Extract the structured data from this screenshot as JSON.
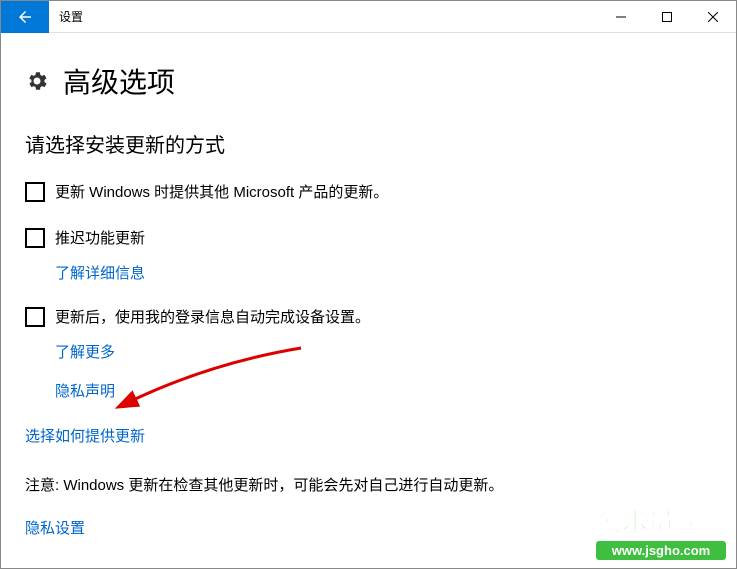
{
  "titlebar": {
    "title": "设置"
  },
  "heading": "高级选项",
  "subheading": "请选择安装更新的方式",
  "options": {
    "opt1": {
      "label": "更新 Windows 时提供其他 Microsoft 产品的更新。"
    },
    "opt2": {
      "label": "推迟功能更新",
      "link": "了解详细信息"
    },
    "opt3": {
      "label": "更新后，使用我的登录信息自动完成设备设置。",
      "link": "了解更多"
    }
  },
  "privacy_notice": "隐私声明",
  "delivery_link": "选择如何提供更新",
  "note": "注意: Windows 更新在检查其他更新时，可能会先对自己进行自动更新。",
  "privacy_settings": "隐私设置",
  "watermark": {
    "line1": "技术员联盟",
    "line2": "www.jsgho.com"
  }
}
